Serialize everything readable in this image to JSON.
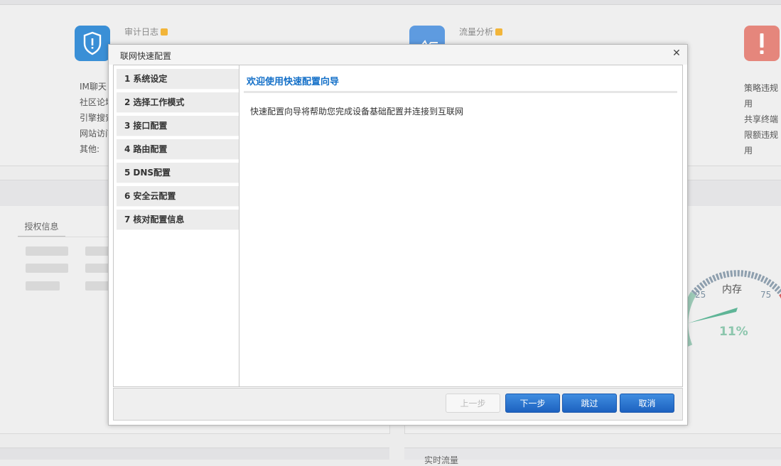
{
  "dashboard": {
    "tiles": [
      {
        "title": "审计日志"
      },
      {
        "title": "流量分析"
      }
    ],
    "left_list": [
      "IM聊天",
      "社区论坛",
      "引擎搜索",
      "网站访问",
      "其他:"
    ],
    "right_list": [
      "策略违规用",
      "共享终端",
      "限额违规用"
    ],
    "auth_tab": "授权信息",
    "gauge": {
      "label": "内存",
      "value_text": "11%",
      "tick_25": "25",
      "tick_75": "75",
      "value": 11
    },
    "bottom_right_title": "实时流量"
  },
  "modal": {
    "title": "联网快速配置",
    "steps": [
      {
        "num": "1",
        "label": "系统设定"
      },
      {
        "num": "2",
        "label": "选择工作模式"
      },
      {
        "num": "3",
        "label": "接口配置"
      },
      {
        "num": "4",
        "label": "路由配置"
      },
      {
        "num": "5",
        "label": "DNS配置"
      },
      {
        "num": "6",
        "label": "安全云配置"
      },
      {
        "num": "7",
        "label": "核对配置信息"
      }
    ],
    "content_title": "欢迎使用快速配置向导",
    "content_text": "快速配置向导将帮助您完成设备基础配置并连接到互联网",
    "buttons": {
      "prev": "上一步",
      "next": "下一步",
      "skip": "跳过",
      "cancel": "取消"
    }
  },
  "colors": {
    "accent": "#1470c8",
    "button": "#2a72cc"
  }
}
